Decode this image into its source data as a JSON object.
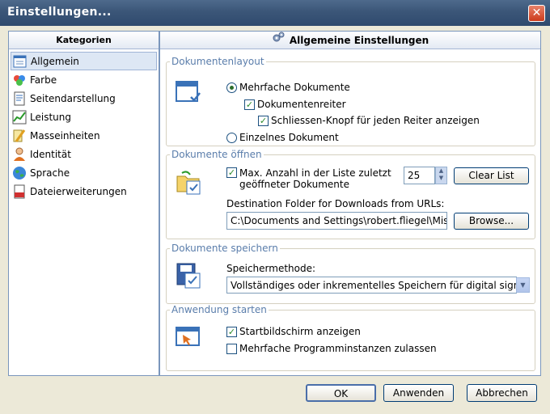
{
  "window": {
    "title": "Einstellungen...",
    "close_glyph": "✕"
  },
  "sidebar": {
    "header": "Kategorien",
    "items": [
      {
        "label": "Allgemein",
        "icon": "settings-list-icon",
        "active": true
      },
      {
        "label": "Farbe",
        "icon": "color-palette-icon"
      },
      {
        "label": "Seitendarstellung",
        "icon": "page-view-icon"
      },
      {
        "label": "Leistung",
        "icon": "performance-chart-icon"
      },
      {
        "label": "Masseinheiten",
        "icon": "ruler-pencil-icon"
      },
      {
        "label": "Identität",
        "icon": "user-identity-icon"
      },
      {
        "label": "Sprache",
        "icon": "globe-icon"
      },
      {
        "label": "Dateierweiterungen",
        "icon": "file-extension-icon"
      }
    ]
  },
  "main": {
    "header": "Allgemeine Einstellungen",
    "layout": {
      "legend": "Dokumentenlayout",
      "multi_docs": "Mehrfache Dokumente",
      "tabs": "Dokumentenreiter",
      "close_button_per_tab": "Schliessen-Knopf für jeden Reiter anzeigen",
      "single_doc": "Einzelnes Dokument"
    },
    "open": {
      "legend": "Dokumente öffnen",
      "max_count_line1": "Max. Anzahl in der Liste zuletzt",
      "max_count_line2": "geöffneter Dokumente",
      "max_count_value": "25",
      "clear_list": "Clear List",
      "dest_label": "Destination Folder for Downloads from URLs:",
      "dest_value": "C:\\Documents and Settings\\robert.fliegel\\Mis documents",
      "browse": "Browse..."
    },
    "save": {
      "legend": "Dokumente speichern",
      "method_label": "Speichermethode:",
      "method_value": "Vollständiges oder inkrementelles Speichern für digital signierte"
    },
    "start": {
      "legend": "Anwendung starten",
      "splash": "Startbildschirm anzeigen",
      "multi_instances": "Mehrfache Programminstanzen zulassen"
    }
  },
  "footer": {
    "ok": "OK",
    "apply": "Anwenden",
    "cancel": "Abbrechen"
  },
  "colors": {
    "title_bar": "#3b5678",
    "group_legend": "#5a7dab",
    "panel_border": "#7a96bc"
  }
}
